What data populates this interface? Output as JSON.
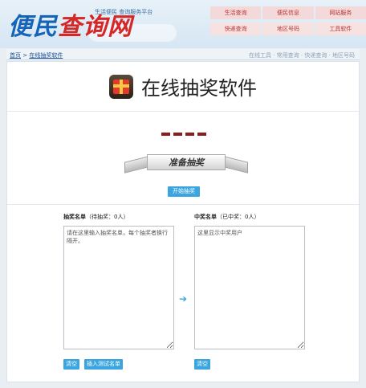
{
  "header": {
    "logo_main": "便民",
    "logo_accent": "查询网",
    "logo_small": "生活便民 查询服务平台",
    "nav_row1": [
      "生活查询",
      "便民信息",
      "网站服务"
    ],
    "nav_row2": [
      "快递查询",
      "地区号码",
      "工具软件"
    ]
  },
  "breadcrumb": {
    "home": "首页",
    "sep": " > ",
    "current": "在线抽奖软件",
    "links": "在线工具 · 常用查询 · 快递查询 · 地区号码"
  },
  "title": {
    "icon": "gift-icon",
    "text": "在线抽奖软件"
  },
  "draw": {
    "ribbon_text": "准备抽奖",
    "start_button": "开始抽奖",
    "dash_count": 4
  },
  "lists": {
    "left_label_bold": "抽奖名单",
    "left_label_rest": "（待抽奖：0人）",
    "left_placeholder": "请在这里输入抽奖名单，每个抽奖者换行隔开。",
    "right_label_bold": "中奖名单",
    "right_label_rest": "（已中奖：0人）",
    "right_placeholder": "这里显示中奖用户",
    "clear_left": "清空",
    "insert_test": "插入测试名单",
    "clear_right": "清空",
    "arrow": "➔"
  },
  "colors": {
    "accent": "#3aa5df",
    "dash": "#8b1d1d",
    "logo_blue": "#1664b8",
    "logo_red": "#d62727"
  }
}
